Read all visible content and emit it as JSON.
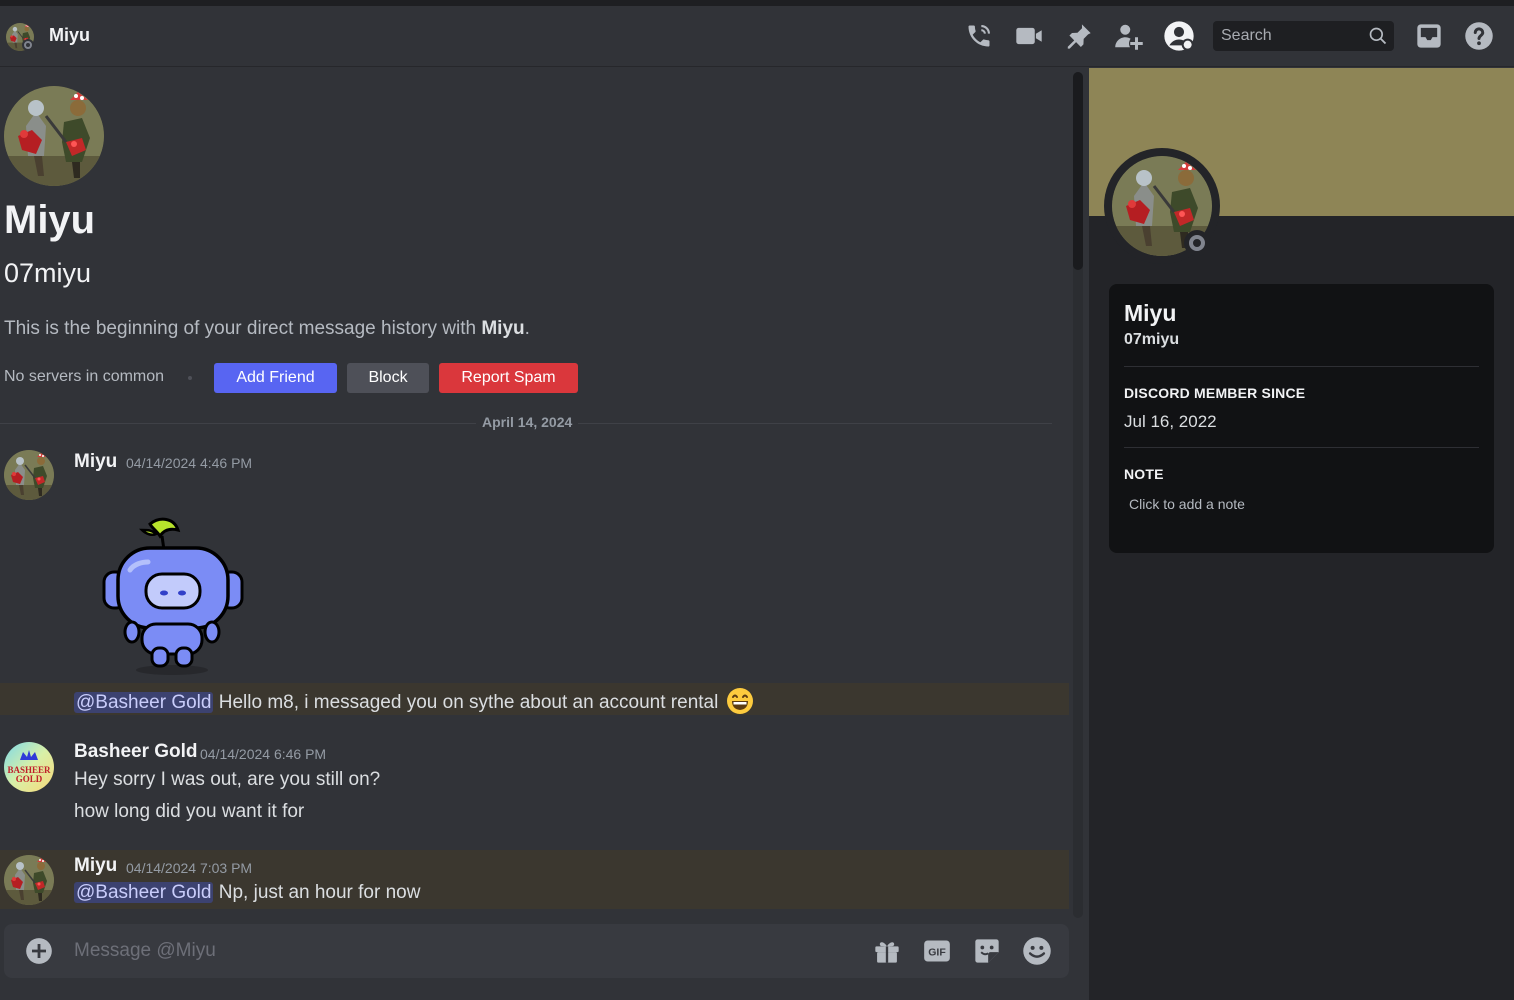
{
  "header": {
    "title": "Miyu",
    "icons": [
      "phone-call-icon",
      "video-call-icon",
      "pin-icon",
      "add-friend-icon",
      "user-profile-toggle-icon",
      "inbox-icon",
      "help-icon"
    ],
    "search_placeholder": "Search"
  },
  "profile": {
    "display_name": "Miyu",
    "username": "07miyu",
    "intro_prefix": "This is the beginning of your direct message history with ",
    "intro_name": "Miyu",
    "intro_suffix": ".",
    "common_servers": "No servers in common",
    "add_friend_label": "Add Friend",
    "block_label": "Block",
    "report_spam_label": "Report Spam"
  },
  "divider_date": "April 14, 2024",
  "messages": [
    {
      "author": "Miyu",
      "timestamp": "04/14/2024 4:46 PM",
      "sticker": "wumpus-sticker",
      "mention": "@Basheer Gold",
      "text": " Hello m8, i messaged you on sythe about an account rental",
      "emoji": "grinning-emoji"
    },
    {
      "author": "Basheer Gold",
      "avatar_text": [
        "BASHEER",
        "GOLD"
      ],
      "timestamp": "04/14/2024 6:46 PM",
      "lines": [
        "Hey sorry I was out, are you still on?",
        "how long did you want it for"
      ]
    },
    {
      "author": "Miyu",
      "timestamp": "04/14/2024 7:03 PM",
      "mention": "@Basheer Gold",
      "text": " Np, just an hour for now"
    }
  ],
  "composer": {
    "placeholder": "Message @Miyu",
    "icons": [
      "gift-icon",
      "gif-icon",
      "sticker-icon",
      "emoji-icon"
    ]
  },
  "panel": {
    "display_name": "Miyu",
    "username": "07miyu",
    "member_since_heading": "DISCORD MEMBER SINCE",
    "member_since_value": "Jul 16, 2022",
    "note_heading": "NOTE",
    "note_placeholder": "Click to add a note"
  },
  "colors": {
    "accent": "#5865f2",
    "danger": "#da373c",
    "banner": "#8e8556",
    "mention_highlight": "#3b372f"
  }
}
